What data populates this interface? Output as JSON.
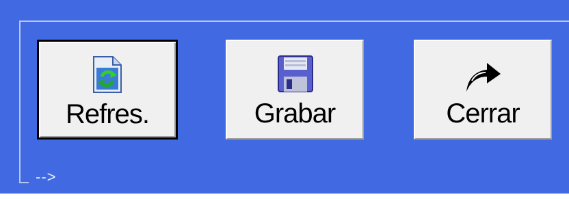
{
  "toolbar": {
    "refresh_label": "Refres.",
    "save_label": "Grabar",
    "close_label": "Cerrar",
    "refresh_icon": "refresh-document-icon",
    "save_icon": "floppy-disk-icon",
    "close_icon": "curved-arrow-icon"
  },
  "footer": {
    "arrow_text": "-->"
  },
  "colors": {
    "panel_background": "#4169E1",
    "button_face": "#F0F0F0"
  }
}
